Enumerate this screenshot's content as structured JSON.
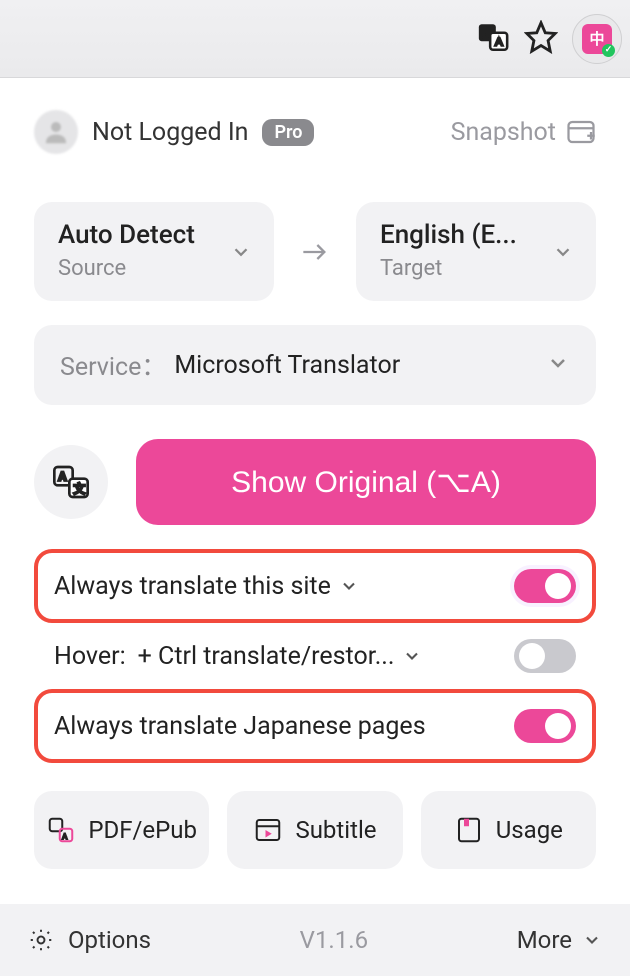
{
  "header": {
    "login_status": "Not Logged In",
    "pro_badge": "Pro",
    "snapshot_label": "Snapshot"
  },
  "lang": {
    "source_title": "Auto Detect",
    "source_sub": "Source",
    "target_title": "English (E...",
    "target_sub": "Target"
  },
  "service": {
    "label": "Service：",
    "value": "Microsoft Translator"
  },
  "main_button": "Show Original (⌥A)",
  "toggles": {
    "always_site": "Always translate this site",
    "hover_label": "Hover:",
    "hover_value": "+ Ctrl translate/restor...",
    "always_lang": "Always translate Japanese pages"
  },
  "cards": {
    "pdf": "PDF/ePub",
    "subtitle": "Subtitle",
    "usage": "Usage"
  },
  "footer": {
    "options": "Options",
    "version": "V1.1.6",
    "more": "More"
  }
}
